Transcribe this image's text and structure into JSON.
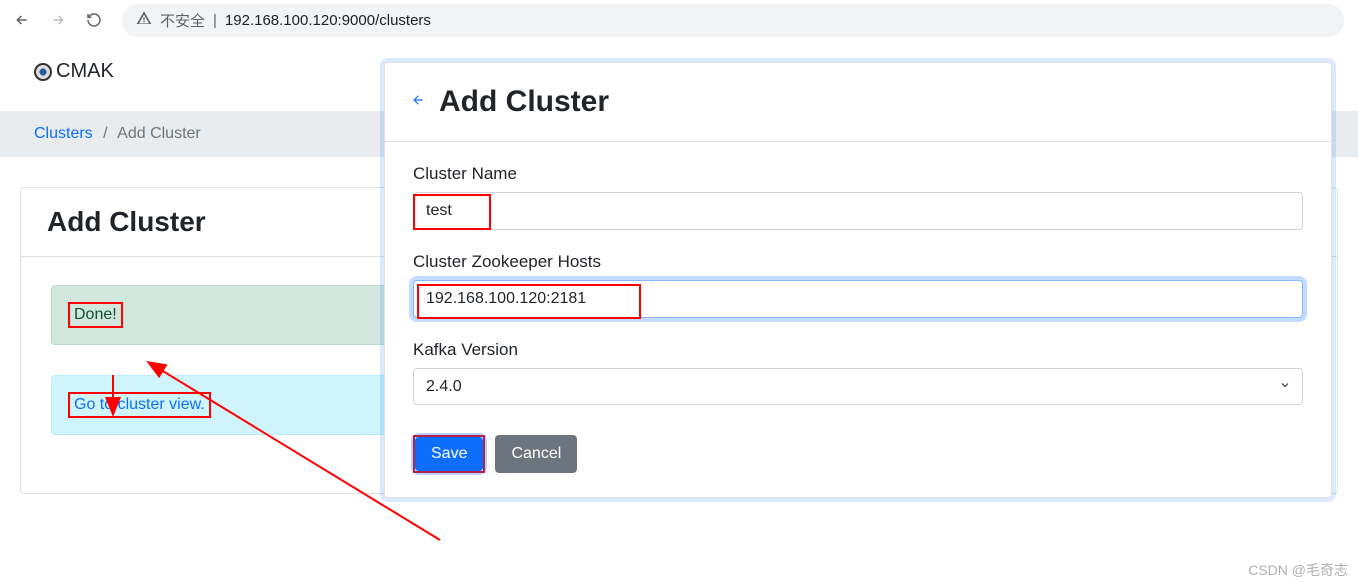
{
  "browser": {
    "insecure_label": "不安全",
    "url": "192.168.100.120:9000/clusters"
  },
  "logo": {
    "text": "CMAK"
  },
  "breadcrumb": {
    "root": "Clusters",
    "current": "Add Cluster"
  },
  "card": {
    "title": "Add Cluster",
    "done_text": "Done!",
    "goto_text": "Go to cluster view."
  },
  "modal": {
    "title": "Add Cluster",
    "form": {
      "cluster_name_label": "Cluster Name",
      "cluster_name_value": "test",
      "zk_label": "Cluster Zookeeper Hosts",
      "zk_value": "192.168.100.120:2181",
      "kafka_version_label": "Kafka Version",
      "kafka_version_value": "2.4.0"
    },
    "save_label": "Save",
    "cancel_label": "Cancel"
  },
  "watermark": "CSDN @毛奇志"
}
